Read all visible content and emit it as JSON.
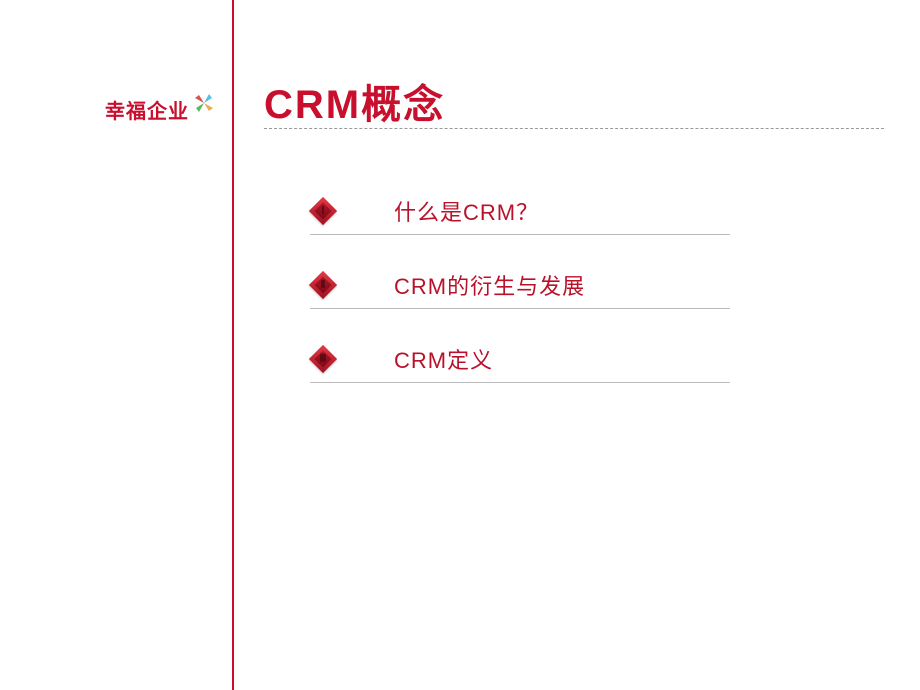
{
  "logo": {
    "text": "幸福企业"
  },
  "title": "CRM概念",
  "items": [
    {
      "number": "Ⅰ",
      "text": "什么是CRM？"
    },
    {
      "number": "Ⅱ",
      "text": "CRM的衍生与发展"
    },
    {
      "number": "Ⅲ",
      "text": "CRM定义"
    }
  ]
}
